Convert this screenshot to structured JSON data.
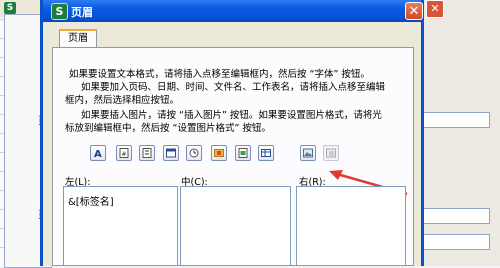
{
  "dialog": {
    "title": "页眉",
    "close_glyph": "✕",
    "tab_label": "页眉",
    "description": {
      "line1": "如果要设置文本格式，请将插入点移至编辑框内，然后按 “字体” 按钮。",
      "line2": "如果要加入页码、日期、时间、文件名、工作表名，请将插入点移至编辑",
      "line3": "框内，然后选择相应按钮。",
      "line4": "如果要插入图片，请按 “插入图片” 按钮。如果要设置图片格式，请将光",
      "line5": "标放到编辑框中，然后按 “设置图片格式” 按钮。"
    },
    "toolbar_icons": [
      "font-icon",
      "page-number-icon",
      "total-pages-icon",
      "date-icon",
      "time-icon",
      "file-path-icon",
      "file-name-icon",
      "sheet-name-icon",
      "insert-picture-icon",
      "format-picture-icon"
    ],
    "sections": {
      "left_label": "左(L):",
      "center_label": "中(C):",
      "right_label": "右(R):",
      "left_value": "&[标签名]",
      "center_value": "",
      "right_value": ""
    }
  },
  "background": {
    "app_icon_glyph": "S",
    "close_glyph": "✕",
    "frag_ye1": "页",
    "frag_ye2": "页"
  },
  "colors": {
    "titlebar": "#0650d7",
    "arrow": "#e03a30",
    "dialog_bg": "#ece9d8"
  }
}
